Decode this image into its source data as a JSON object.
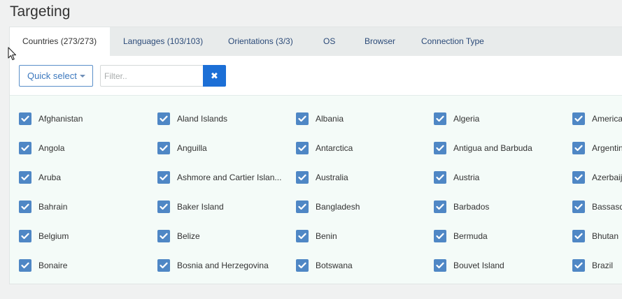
{
  "page": {
    "title": "Targeting"
  },
  "tabs": [
    {
      "label": "Countries (273/273)",
      "active": true
    },
    {
      "label": "Languages (103/103)",
      "active": false
    },
    {
      "label": "Orientations (3/3)",
      "active": false
    },
    {
      "label": "OS",
      "active": false
    },
    {
      "label": "Browser",
      "active": false
    },
    {
      "label": "Connection Type",
      "active": false
    }
  ],
  "toolbar": {
    "quick_select_label": "Quick select",
    "filter_placeholder": "Filter..",
    "filter_value": "",
    "clear_icon": "close-icon"
  },
  "countries": [
    [
      "Afghanistan",
      "Aland Islands",
      "Albania",
      "Algeria",
      "America"
    ],
    [
      "Angola",
      "Anguilla",
      "Antarctica",
      "Antigua and Barbuda",
      "Argentin"
    ],
    [
      "Aruba",
      "Ashmore and Cartier Islan...",
      "Australia",
      "Austria",
      "Azerbaija"
    ],
    [
      "Bahrain",
      "Baker Island",
      "Bangladesh",
      "Barbados",
      "Bassasd"
    ],
    [
      "Belgium",
      "Belize",
      "Benin",
      "Bermuda",
      "Bhutan"
    ],
    [
      "Bonaire",
      "Bosnia and Herzegovina",
      "Botswana",
      "Bouvet Island",
      "Brazil"
    ]
  ],
  "colors": {
    "accent": "#1c6fd6",
    "checkbox": "#4f87c5",
    "tab_text": "#2b4a78"
  }
}
